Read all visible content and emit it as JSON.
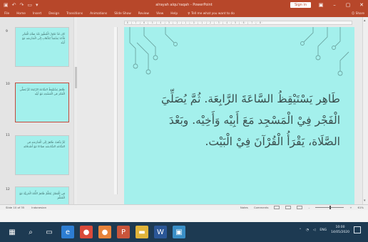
{
  "window": {
    "title": "alrayah alqu'raqah - PowerPoint",
    "sign_in": "Sign in",
    "qat": [
      "save-icon",
      "undo-icon",
      "redo-icon",
      "present-icon",
      "customize-icon"
    ]
  },
  "ribbon": {
    "tabs": [
      "File",
      "Home",
      "Insert",
      "Design",
      "Transitions",
      "Animations",
      "Slide Show",
      "Review",
      "View",
      "Help"
    ],
    "tell_me": "Tell me what you want to do",
    "share": "Share"
  },
  "slides_panel": {
    "items": [
      {
        "number": "9",
        "text": "كان قَدْ تَنَاوَلَ الْفُطُورَ بَعْدَ صَلَاةِ الْفَجْرِ فَأَخَذَ يَسْتَعِدُّ لِلذَّهَابِ إِلَى الْمَدْرَسَةِ مَعَ أَبِيْهِ"
      },
      {
        "number": "10",
        "text": "طَاهِرٌ يَسْتَيْقِظُ السَّاعَةَ الرَّابِعَةَ ثُمَّ يُصَلِّي الْفَجْرَ فِي الْمَسْجِدِ مَعَ أَبِيْهِ"
      },
      {
        "number": "11",
        "text": "ثُمَّ يَذْهَبُ طَاهِرٌ إِلَى الْمَدْرَسَةِ فِي السَّاعَةِ السَّادِسَةِ صَبَاحًا مَعَ أَصْدِقَائِهِ"
      },
      {
        "number": "12",
        "text": "فِي الْفَصْلِ يَتَعَلَّمُ طَاهِرٌ اللُّغَةَ الْعَرَبِيَّةَ مَعَ الْمُعَلِّمِ"
      }
    ]
  },
  "slide": {
    "text": "طَاهِر يَسْتَيْقِظُ السَّاعَةَ الرَّابِعَة. ثُمَّ يُصَلِّيَ الْفَجْر فِيْ الْمَسْجِد مَعَ أَبِيْه وَأَخِيْه. وبَعْدَ الصَّلَاة، يَقْرَأُ الْقُرْآنَ فِيْ الْبَيْت.",
    "background": "#a4f0ec",
    "text_color": "#3a4f4e"
  },
  "status_bar": {
    "slide_info": "Slide 10 of 35",
    "language": "Indonesian",
    "notes": "Notes",
    "comments": "Comments",
    "zoom": "61%"
  },
  "taskbar": {
    "time": "10:00",
    "date": "14/05/2020",
    "lang": "ENG",
    "apps": [
      {
        "name": "start-icon",
        "glyph": "▦",
        "color": "#1d3a52"
      },
      {
        "name": "search-icon",
        "glyph": "⌕",
        "color": "#1d3a52"
      },
      {
        "name": "taskview-icon",
        "glyph": "▭",
        "color": "#1d3a52"
      },
      {
        "name": "edge-icon",
        "glyph": "e",
        "color": "#2d7dd2"
      },
      {
        "name": "chrome-icon",
        "glyph": "●",
        "color": "#d94a3a"
      },
      {
        "name": "firefox-icon",
        "glyph": "●",
        "color": "#e8833a"
      },
      {
        "name": "powerpoint-icon",
        "glyph": "P",
        "color": "#c9553b"
      },
      {
        "name": "explorer-icon",
        "glyph": "▬",
        "color": "#e0b43a"
      },
      {
        "name": "word-icon",
        "glyph": "W",
        "color": "#2b5797"
      },
      {
        "name": "photos-icon",
        "glyph": "▣",
        "color": "#3a8fc7"
      }
    ]
  }
}
